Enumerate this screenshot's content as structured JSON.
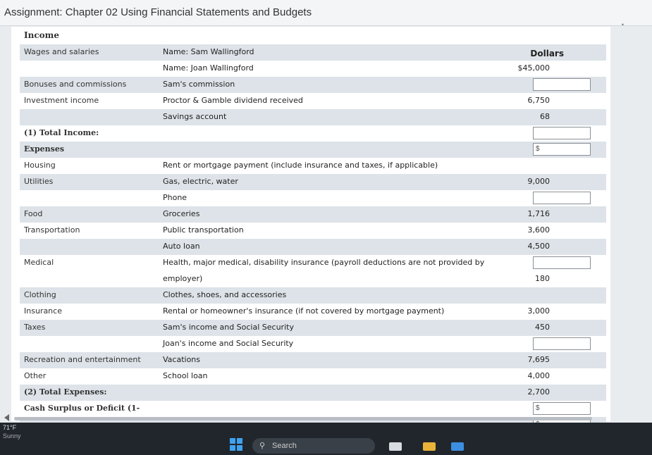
{
  "header": {
    "title": "Assignment: Chapter 02 Using Financial Statements and Budgets"
  },
  "table": {
    "income_heading": "Income",
    "dollars_heading": "Dollars",
    "rows": [
      {
        "cat": "Wages and salaries",
        "desc": "Name: Sam Wallingford",
        "val": "",
        "input": false,
        "shade": true,
        "dollars": true
      },
      {
        "cat": "",
        "desc": "Name: Joan Wallingford",
        "val": "$45,000",
        "input": false,
        "shade": false
      },
      {
        "cat": "Bonuses and commissions",
        "desc": "Sam's commission",
        "val": "",
        "input": true,
        "shade": true
      },
      {
        "cat": "Investment income",
        "desc": "Proctor & Gamble dividend received",
        "val": "6,750",
        "input": false,
        "shade": false
      },
      {
        "cat": "",
        "desc": "Savings account",
        "val": "68",
        "input": false,
        "shade": true
      },
      {
        "cat": "(1) Total Income:",
        "desc": "",
        "val": "",
        "input": true,
        "shade": false,
        "bold": true
      },
      {
        "cat": "Expenses",
        "desc": "",
        "val": "",
        "input": true,
        "prefix": "$",
        "shade": true,
        "bold": true
      },
      {
        "cat": "Housing",
        "desc": "Rent or mortgage payment (include insurance and taxes, if applicable)",
        "val": "",
        "input": false,
        "shade": false
      },
      {
        "cat": "Utilities",
        "desc": "Gas, electric, water",
        "val": "9,000",
        "input": false,
        "shade": true
      },
      {
        "cat": "",
        "desc": "Phone",
        "val": "",
        "input": true,
        "shade": false
      },
      {
        "cat": "Food",
        "desc": "Groceries",
        "val": "1,716",
        "input": false,
        "shade": true
      },
      {
        "cat": "Transportation",
        "desc": "Public transportation",
        "val": "3,600",
        "input": false,
        "shade": false
      },
      {
        "cat": "",
        "desc": "Auto loan",
        "val": "4,500",
        "input": false,
        "shade": true
      },
      {
        "cat": "Medical",
        "desc": "Health, major medical, disability insurance (payroll deductions are not provided by",
        "val": "",
        "input": true,
        "shade": false
      },
      {
        "cat": "",
        "desc": "employer)",
        "val": "180",
        "input": false,
        "shade": false
      },
      {
        "cat": "Clothing",
        "desc": "Clothes, shoes, and accessories",
        "val": "",
        "input": false,
        "shade": true
      },
      {
        "cat": "Insurance",
        "desc": "Rental or homeowner's insurance (if not covered by mortgage payment)",
        "val": "3,000",
        "input": false,
        "shade": false
      },
      {
        "cat": "Taxes",
        "desc": "Sam's income and Social Security",
        "val": "450",
        "input": false,
        "shade": true
      },
      {
        "cat": "",
        "desc": "Joan's income and Social Security",
        "val": "",
        "input": true,
        "shade": false
      },
      {
        "cat": "Recreation and entertainment",
        "desc": "Vacations",
        "val": "7,695",
        "input": false,
        "shade": true
      },
      {
        "cat": "Other",
        "desc": "School loan",
        "val": "4,000",
        "input": false,
        "shade": false
      },
      {
        "cat": "(2) Total Expenses:",
        "desc": "",
        "val": "2,700",
        "input": false,
        "shade": true,
        "bold": true
      },
      {
        "cat": "Cash Surplus or Deficit (1-",
        "desc": "",
        "val": "",
        "input": true,
        "prefix": "$",
        "shade": false,
        "bold": true
      },
      {
        "cat": "",
        "desc": "",
        "val": "",
        "input": true,
        "prefix": "$",
        "shade": true
      }
    ]
  },
  "taskbar": {
    "temperature": "71°F",
    "condition": "Sunny",
    "search_label": "Search",
    "search_icon": "search-icon",
    "windows_icon": "windows-start-icon"
  },
  "colors": {
    "row_shade": "#dde3e8",
    "taskbar": "#20262c",
    "accent": "#3fa2f0"
  }
}
